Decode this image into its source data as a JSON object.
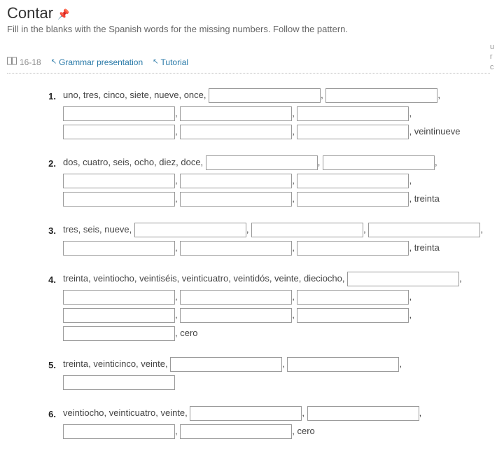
{
  "title": "Contar",
  "subtitle": "Fill in the blanks with the Spanish words for the missing numbers. Follow the pattern.",
  "refs": {
    "pages": "16-18",
    "grammar": "Grammar presentation",
    "tutorial": "Tutorial"
  },
  "questions": [
    {
      "num": "1.",
      "segments": [
        {
          "t": "text",
          "v": "uno, tres, cinco, siete, nueve, once, "
        },
        {
          "t": "blank"
        },
        {
          "t": "text",
          "v": ", "
        },
        {
          "t": "blank"
        },
        {
          "t": "text",
          "v": ", "
        },
        {
          "t": "blank"
        },
        {
          "t": "text",
          "v": ", "
        },
        {
          "t": "blank"
        },
        {
          "t": "text",
          "v": ", "
        },
        {
          "t": "blank"
        },
        {
          "t": "text",
          "v": ", "
        },
        {
          "t": "blank"
        },
        {
          "t": "text",
          "v": ", "
        },
        {
          "t": "blank"
        },
        {
          "t": "text",
          "v": ", "
        },
        {
          "t": "blank"
        },
        {
          "t": "text",
          "v": ", veintinueve"
        }
      ]
    },
    {
      "num": "2.",
      "segments": [
        {
          "t": "text",
          "v": "dos, cuatro, seis, ocho, diez, doce, "
        },
        {
          "t": "blank"
        },
        {
          "t": "text",
          "v": ", "
        },
        {
          "t": "blank"
        },
        {
          "t": "text",
          "v": ", "
        },
        {
          "t": "blank"
        },
        {
          "t": "text",
          "v": ", "
        },
        {
          "t": "blank"
        },
        {
          "t": "text",
          "v": ", "
        },
        {
          "t": "blank"
        },
        {
          "t": "text",
          "v": ", "
        },
        {
          "t": "blank"
        },
        {
          "t": "text",
          "v": ", "
        },
        {
          "t": "blank"
        },
        {
          "t": "text",
          "v": ", "
        },
        {
          "t": "blank"
        },
        {
          "t": "text",
          "v": ", treinta"
        }
      ]
    },
    {
      "num": "3.",
      "segments": [
        {
          "t": "text",
          "v": "tres, seis, nueve, "
        },
        {
          "t": "blank"
        },
        {
          "t": "text",
          "v": ", "
        },
        {
          "t": "blank"
        },
        {
          "t": "text",
          "v": ", "
        },
        {
          "t": "blank"
        },
        {
          "t": "text",
          "v": ", "
        },
        {
          "t": "blank"
        },
        {
          "t": "text",
          "v": ", "
        },
        {
          "t": "blank"
        },
        {
          "t": "text",
          "v": ", "
        },
        {
          "t": "blank"
        },
        {
          "t": "text",
          "v": ", treinta"
        }
      ]
    },
    {
      "num": "4.",
      "segments": [
        {
          "t": "text",
          "v": "treinta, veintiocho, veintiséis, veinticuatro, veintidós, veinte, dieciocho, "
        },
        {
          "t": "blank"
        },
        {
          "t": "text",
          "v": ", "
        },
        {
          "t": "blank"
        },
        {
          "t": "text",
          "v": ", "
        },
        {
          "t": "blank"
        },
        {
          "t": "text",
          "v": ", "
        },
        {
          "t": "blank"
        },
        {
          "t": "text",
          "v": ", "
        },
        {
          "t": "blank"
        },
        {
          "t": "text",
          "v": ", "
        },
        {
          "t": "blank"
        },
        {
          "t": "text",
          "v": ", "
        },
        {
          "t": "blank"
        },
        {
          "t": "text",
          "v": ", "
        },
        {
          "t": "blank"
        },
        {
          "t": "text",
          "v": ", cero"
        }
      ]
    },
    {
      "num": "5.",
      "segments": [
        {
          "t": "text",
          "v": "treinta, veinticinco, veinte, "
        },
        {
          "t": "blank"
        },
        {
          "t": "text",
          "v": ", "
        },
        {
          "t": "blank"
        },
        {
          "t": "text",
          "v": ", "
        },
        {
          "t": "blank"
        }
      ]
    },
    {
      "num": "6.",
      "segments": [
        {
          "t": "text",
          "v": "veintiocho, veinticuatro, veinte, "
        },
        {
          "t": "blank"
        },
        {
          "t": "text",
          "v": ", "
        },
        {
          "t": "blank"
        },
        {
          "t": "text",
          "v": ", "
        },
        {
          "t": "blank"
        },
        {
          "t": "text",
          "v": ", "
        },
        {
          "t": "blank"
        },
        {
          "t": "text",
          "v": ", cero"
        }
      ]
    }
  ]
}
